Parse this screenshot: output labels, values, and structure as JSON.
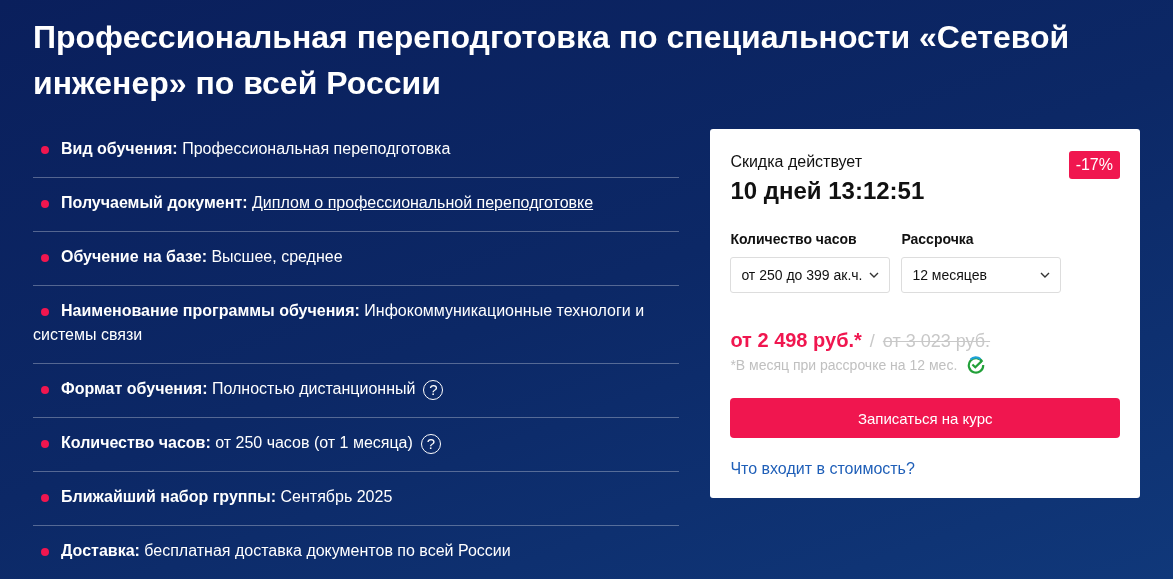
{
  "title": "Профессиональная переподготовка по специальности «Сетевой инженер» по всей России",
  "features": [
    {
      "kind": "text",
      "label": "Вид обучения:",
      "value": "Профессиональная переподготовка"
    },
    {
      "kind": "link",
      "label": "Получаемый документ:",
      "value": "Диплом о профессиональной переподготовке"
    },
    {
      "kind": "text",
      "label": "Обучение на базе:",
      "value": "Высшее, среднее"
    },
    {
      "kind": "text",
      "label": "Наименование программы обучения:",
      "value": "Инфокоммуникационные технологи и системы связи"
    },
    {
      "kind": "help",
      "label": "Формат обучения:",
      "value": "Полностью дистанционный",
      "help": "?"
    },
    {
      "kind": "help",
      "label": "Количество часов:",
      "value": "от 250 часов (от 1 месяца)",
      "help": "?"
    },
    {
      "kind": "text",
      "label": "Ближайший набор группы:",
      "value": "Сентябрь 2025"
    },
    {
      "kind": "text",
      "label": "Доставка:",
      "value": "бесплатная доставка документов по всей России"
    }
  ],
  "offer": {
    "discount_label": "Скидка действует",
    "timer": "10 дней 13:12:51",
    "badge": "-17%",
    "selects": [
      {
        "label": "Количество часов",
        "value": "от 250 до 399 ак.ч."
      },
      {
        "label": "Рассрочка",
        "value": "12 месяцев"
      }
    ],
    "price": "от 2 498 руб.*",
    "separator": "/",
    "old_price": "от 3 023 руб.",
    "note": "*В месяц при рассрочке на 12 мес.",
    "button": "Записаться на курс",
    "link": "Что входит в стоимость?"
  }
}
